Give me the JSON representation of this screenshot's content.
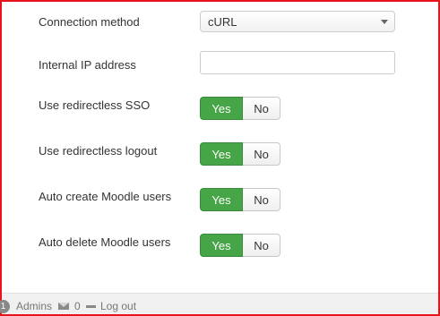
{
  "form": {
    "connection_method": {
      "label": "Connection method",
      "value": "cURL"
    },
    "internal_ip": {
      "label": "Internal IP address",
      "value": "",
      "placeholder": ""
    },
    "toggles": [
      {
        "label": "Use redirectless SSO",
        "yes": "Yes",
        "no": "No",
        "selected": "Yes"
      },
      {
        "label": "Use redirectless logout",
        "yes": "Yes",
        "no": "No",
        "selected": "Yes"
      },
      {
        "label": "Auto create Moodle users",
        "yes": "Yes",
        "no": "No",
        "selected": "Yes"
      },
      {
        "label": "Auto delete Moodle users",
        "yes": "Yes",
        "no": "No",
        "selected": "Yes"
      }
    ]
  },
  "footer": {
    "badge": "1",
    "admins": "Admins",
    "message_icon": "envelope-icon",
    "message_count": "0",
    "logout_icon": "minus-icon",
    "logout": "Log out"
  },
  "colors": {
    "yes_active": "#46a546",
    "frame_border": "#e8141c"
  }
}
